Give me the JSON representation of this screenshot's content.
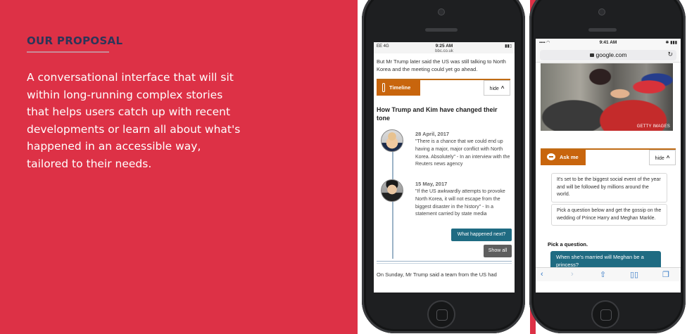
{
  "left": {
    "title": "OUR PROPOSAL",
    "body": "A conversational interface that will sit within long-running complex stories that helps users catch up with recent developments or learn all about what's happened in an accessible way, tailored to their needs."
  },
  "phone1": {
    "status": {
      "carrier": "EE 4G",
      "time": "9:25 AM",
      "url": "bbc.co.uk"
    },
    "intro_text": "But Mr Trump later said the US was still talking to North Korea and the meeting could yet go ahead.",
    "timeline_label": "Timeline",
    "hide_label": "hide",
    "heading": "How Trump and Kim have changed their tone",
    "entries": [
      {
        "date": "28 April, 2017",
        "text": "\"There is a chance that we could end up having a major, major conflict with North Korea. Absolutely\" - In an interview with the Reuters news agency"
      },
      {
        "date": "15 May, 2017",
        "text": "\"If the US awkwardly attempts to provoke North Korea, it will not escape from the biggest disaster in the history\" - In a statement carried by state media"
      }
    ],
    "what_next_label": "What happened next?",
    "show_all_label": "Show all",
    "footer_text": "On Sunday, Mr Trump said a team from the US had"
  },
  "phone2": {
    "status": {
      "time": "9:41 AM"
    },
    "address": "google.com",
    "photo_credit": "GETTY IMAGES",
    "askme_label": "Ask me",
    "hide_label": "hide",
    "bubbles": [
      "It's set to be the biggest social event of the year and will be followed by millions around the world.",
      "Pick a question below and get the gossip on the wedding of Prince Harry and Meghan Markle."
    ],
    "pick_label": "Pick a question.",
    "question": "When she's married will Meghan be a princess?"
  },
  "colors": {
    "accent_red": "#dd3146",
    "navy": "#2d3558",
    "orange": "#c8650d",
    "teal": "#1f6b82"
  }
}
